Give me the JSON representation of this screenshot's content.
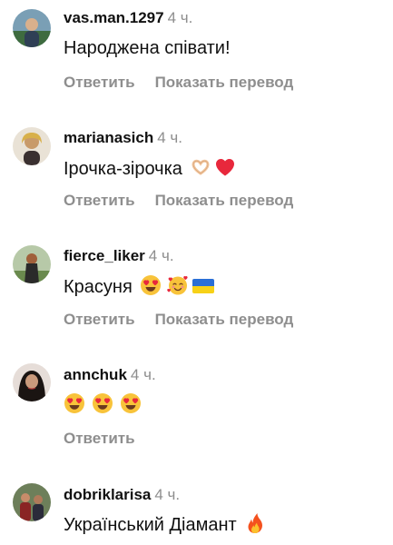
{
  "comments": [
    {
      "username": "vas.man.1297",
      "time": "4 ч.",
      "text": "Народжена співати!",
      "reply": "Ответить",
      "translate": "Показать перевод"
    },
    {
      "username": "marianasich",
      "time": "4 ч.",
      "text": "Ірочка-зірочка",
      "reply": "Ответить",
      "translate": "Показать перевод"
    },
    {
      "username": "fierce_liker",
      "time": "4 ч.",
      "text": "Красуня",
      "reply": "Ответить",
      "translate": "Показать перевод"
    },
    {
      "username": "annchuk",
      "time": "4 ч.",
      "text": "",
      "reply": "Ответить"
    },
    {
      "username": "dobriklarisa",
      "time": "4 ч.",
      "text": "Український Діамант"
    }
  ],
  "icons": {
    "c2": [
      "heart-hands-icon",
      "red-heart-icon"
    ],
    "c3": [
      "heart-eyes-icon",
      "smiling-face-hearts-icon",
      "ukraine-flag-icon"
    ],
    "c4": [
      "heart-eyes-icon",
      "heart-eyes-icon",
      "heart-eyes-icon"
    ],
    "c5": [
      "fire-icon"
    ]
  },
  "colors": {
    "text": "#111111",
    "secondary": "#8e8e8e",
    "background": "#ffffff"
  }
}
